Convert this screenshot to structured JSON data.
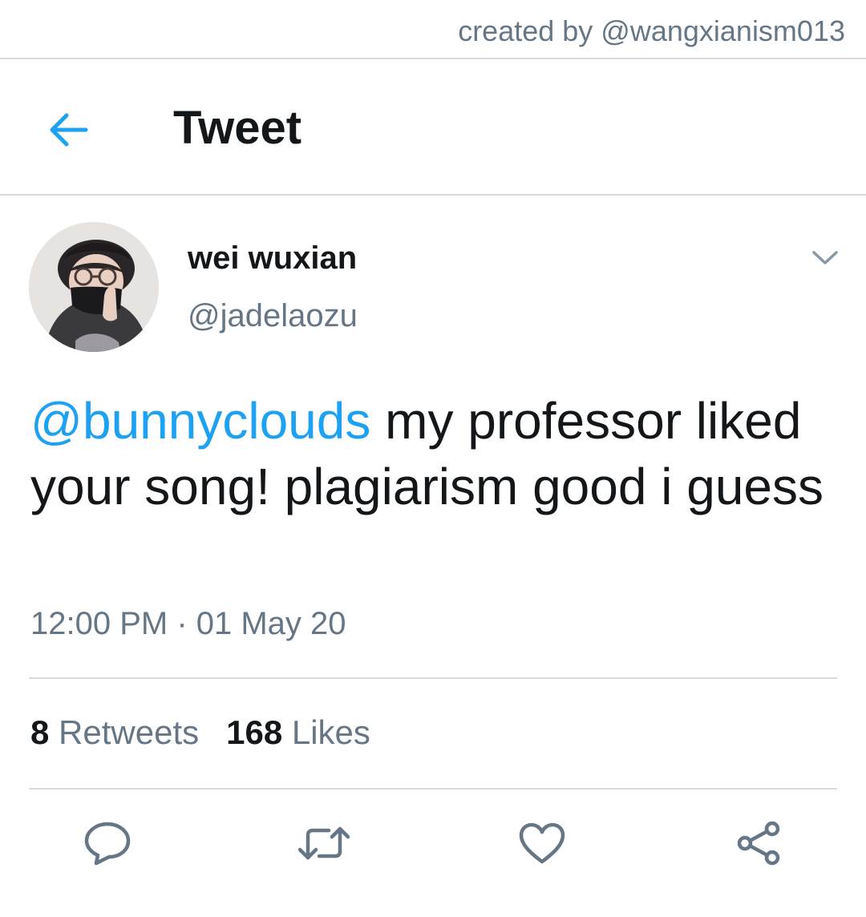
{
  "watermark": "created by @wangxianism013",
  "header": {
    "title": "Tweet",
    "back_icon": "arrow-left-icon"
  },
  "tweet": {
    "author": {
      "name": "wei wuxian",
      "handle": "@jadelaozu"
    },
    "text": {
      "mention": "@bunnyclouds",
      "body": " my professor liked your song! plagiarism good i guess"
    },
    "timestamp": "12:00 PM · 01 May 20",
    "stats": {
      "retweets_count": "8",
      "retweets_label": "Retweets",
      "likes_count": "168",
      "likes_label": "Likes"
    },
    "actions": [
      "reply-icon",
      "retweet-icon",
      "like-icon",
      "share-icon"
    ]
  },
  "colors": {
    "accent": "#1da1f2",
    "secondary_text": "#657786",
    "primary_text": "#14171a",
    "divider": "#d6dbe0"
  }
}
